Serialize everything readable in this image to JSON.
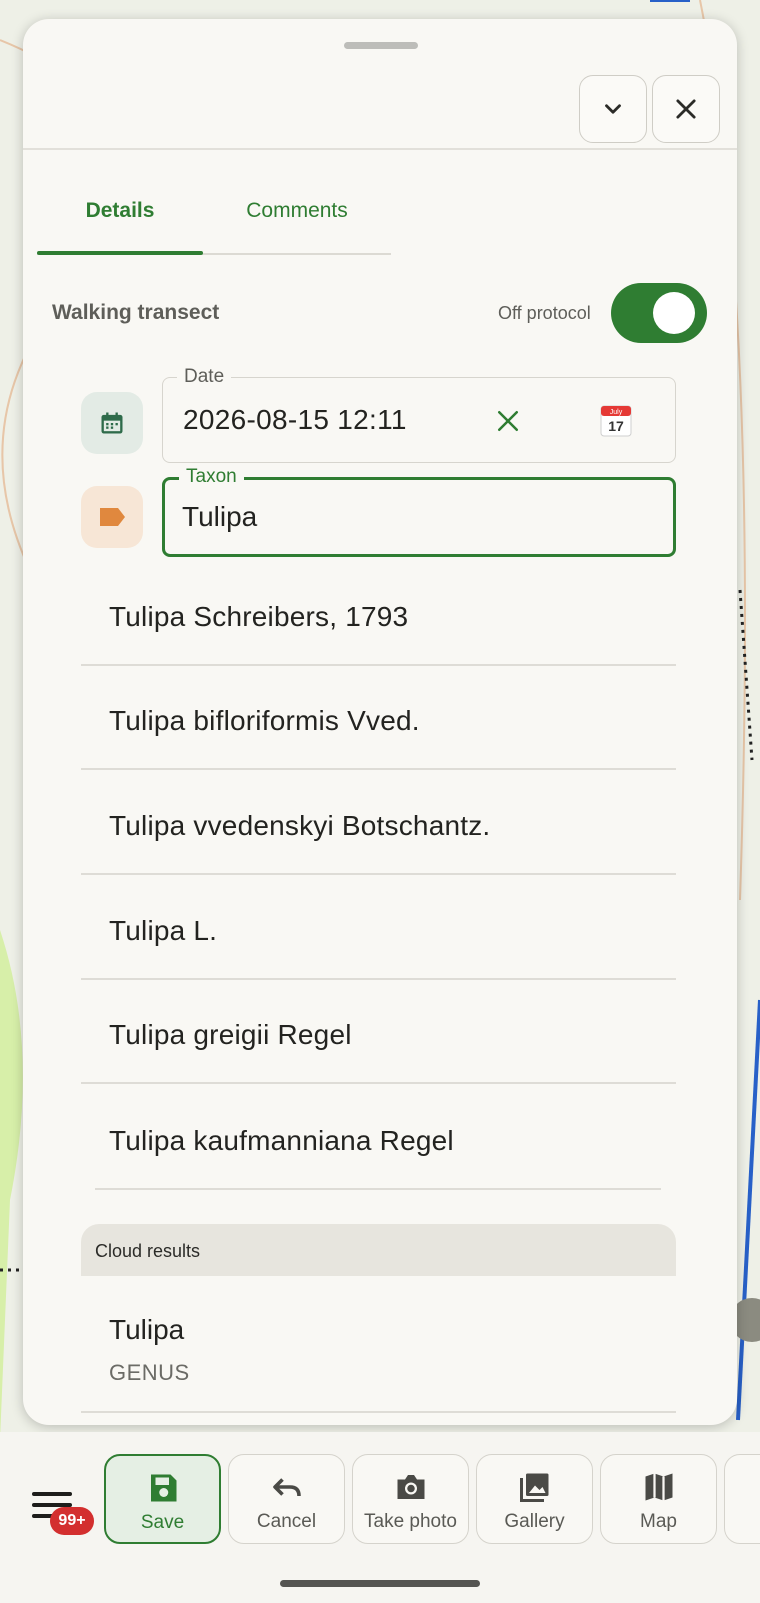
{
  "header": {
    "collapse_icon": "chevron-down-icon",
    "close_icon": "close-icon"
  },
  "tabs": [
    {
      "label": "Details",
      "active": true
    },
    {
      "label": "Comments",
      "active": false
    }
  ],
  "protocol": {
    "title": "Walking transect",
    "off_protocol_label": "Off protocol",
    "off_protocol_on": true
  },
  "date_field": {
    "label": "Date",
    "value": "2026-08-15 12:11",
    "calendar_day": "17",
    "calendar_month": "July"
  },
  "taxon_field": {
    "label": "Taxon",
    "value": "Tulipa"
  },
  "suggestions": [
    "Tulipa Schreibers, 1793",
    "Tulipa bifloriformis Vved.",
    "Tulipa vvedenskyi Botschantz.",
    "Tulipa L.",
    "Tulipa greigii Regel",
    "Tulipa kaufmanniana Regel"
  ],
  "cloud_results": {
    "header": "Cloud results",
    "items": [
      {
        "name": "Tulipa",
        "rank": "GENUS"
      }
    ]
  },
  "bottom_bar": {
    "badge": "99+",
    "actions": [
      {
        "label": "Save",
        "icon": "save-icon"
      },
      {
        "label": "Cancel",
        "icon": "undo-icon"
      },
      {
        "label": "Take photo",
        "icon": "camera-icon"
      },
      {
        "label": "Gallery",
        "icon": "gallery-icon"
      },
      {
        "label": "Map",
        "icon": "map-icon"
      }
    ]
  },
  "colors": {
    "accent": "#2f7d32",
    "badge": "#d32f2f",
    "taxon_icon": "#e0883e"
  }
}
